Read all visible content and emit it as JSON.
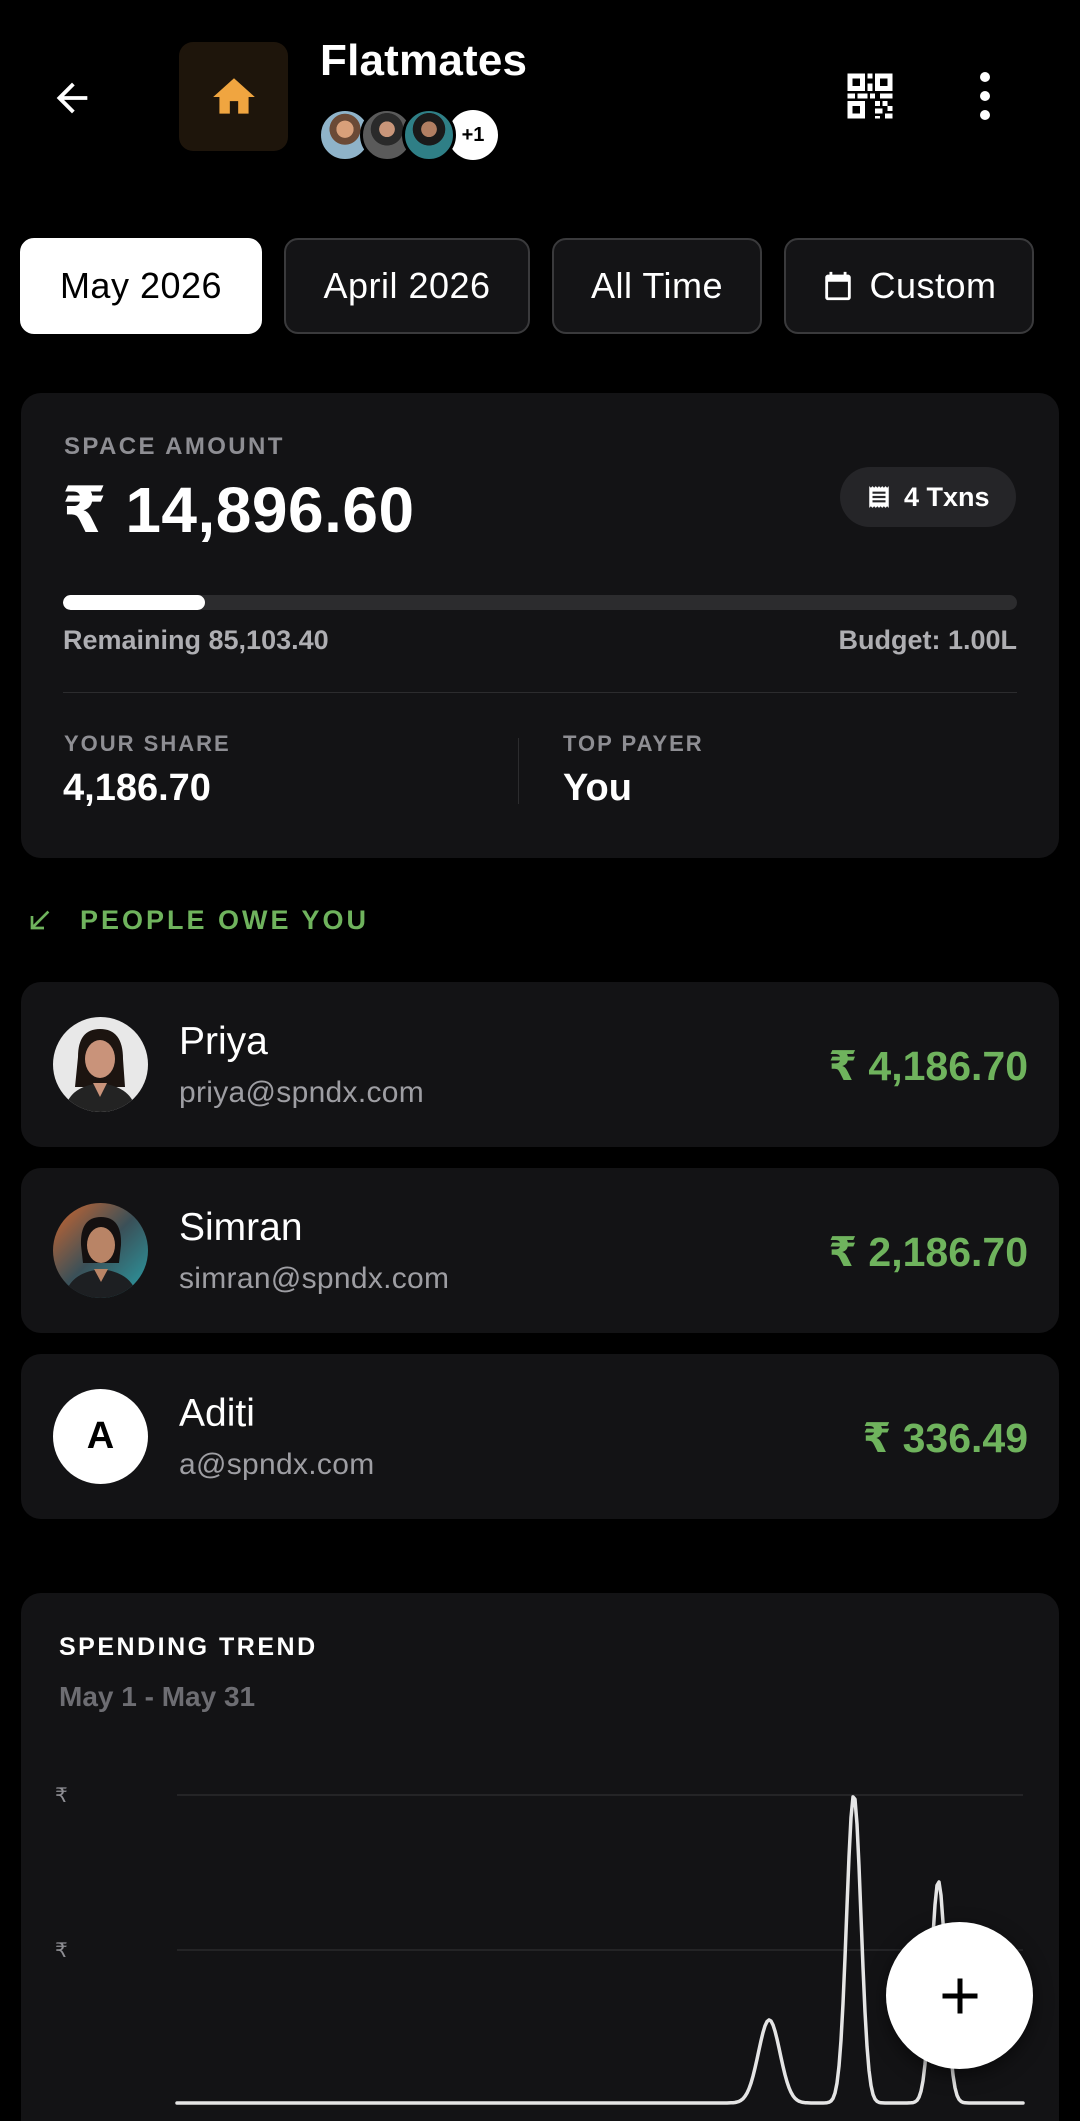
{
  "header": {
    "title": "Flatmates",
    "extra_members": "+1",
    "member_names": [
      "member-1",
      "member-2",
      "member-3"
    ]
  },
  "filters": {
    "chips": [
      "May 2026",
      "April 2026",
      "All Time",
      "Custom"
    ],
    "selected": "May 2026"
  },
  "summary": {
    "label": "SPACE AMOUNT",
    "amount": "₹ 14,896.60",
    "txns": "4 Txns",
    "budget_used_fraction": 0.149,
    "remaining": "Remaining 85,103.40",
    "budget": "Budget: 1.00L",
    "your_share_label": "YOUR SHARE",
    "your_share": "4,186.70",
    "top_payer_label": "TOP PAYER",
    "top_payer": "You"
  },
  "owe_section": {
    "title": "PEOPLE OWE YOU",
    "people": [
      {
        "name": "Priya",
        "email": "priya@spndx.com",
        "amount": "₹ 4,186.70",
        "avatar": "photo"
      },
      {
        "name": "Simran",
        "email": "simran@spndx.com",
        "amount": "₹ 2,186.70",
        "avatar": "photo"
      },
      {
        "name": "Aditi",
        "email": "a@spndx.com",
        "amount": "₹ 336.49",
        "avatar": "A"
      }
    ]
  },
  "trend": {
    "title": "SPENDING TREND",
    "range": "May 1 - May 31",
    "y_tick_symbol": "₹"
  },
  "chart_data": {
    "type": "line",
    "title": "SPENDING TREND",
    "xlabel": "",
    "ylabel": "",
    "x_range": [
      "May 1",
      "May 31"
    ],
    "grid": true,
    "note_visible_peaks": [
      {
        "x_fraction_of_month": 0.7,
        "relative_value": 0.27
      },
      {
        "x_fraction_of_month": 0.8,
        "relative_value": 1.0
      },
      {
        "x_fraction_of_month": 0.9,
        "relative_value": 0.72
      }
    ]
  },
  "colors": {
    "accent_green": "#6fb35d",
    "home_icon": "#f0a540",
    "background": "#000000",
    "card": "#131315"
  },
  "icons": [
    "back-arrow-icon",
    "home-icon",
    "qr-code-icon",
    "more-vert-icon",
    "calendar-icon",
    "receipt-icon",
    "arrow-down-left-icon",
    "plus-icon"
  ]
}
